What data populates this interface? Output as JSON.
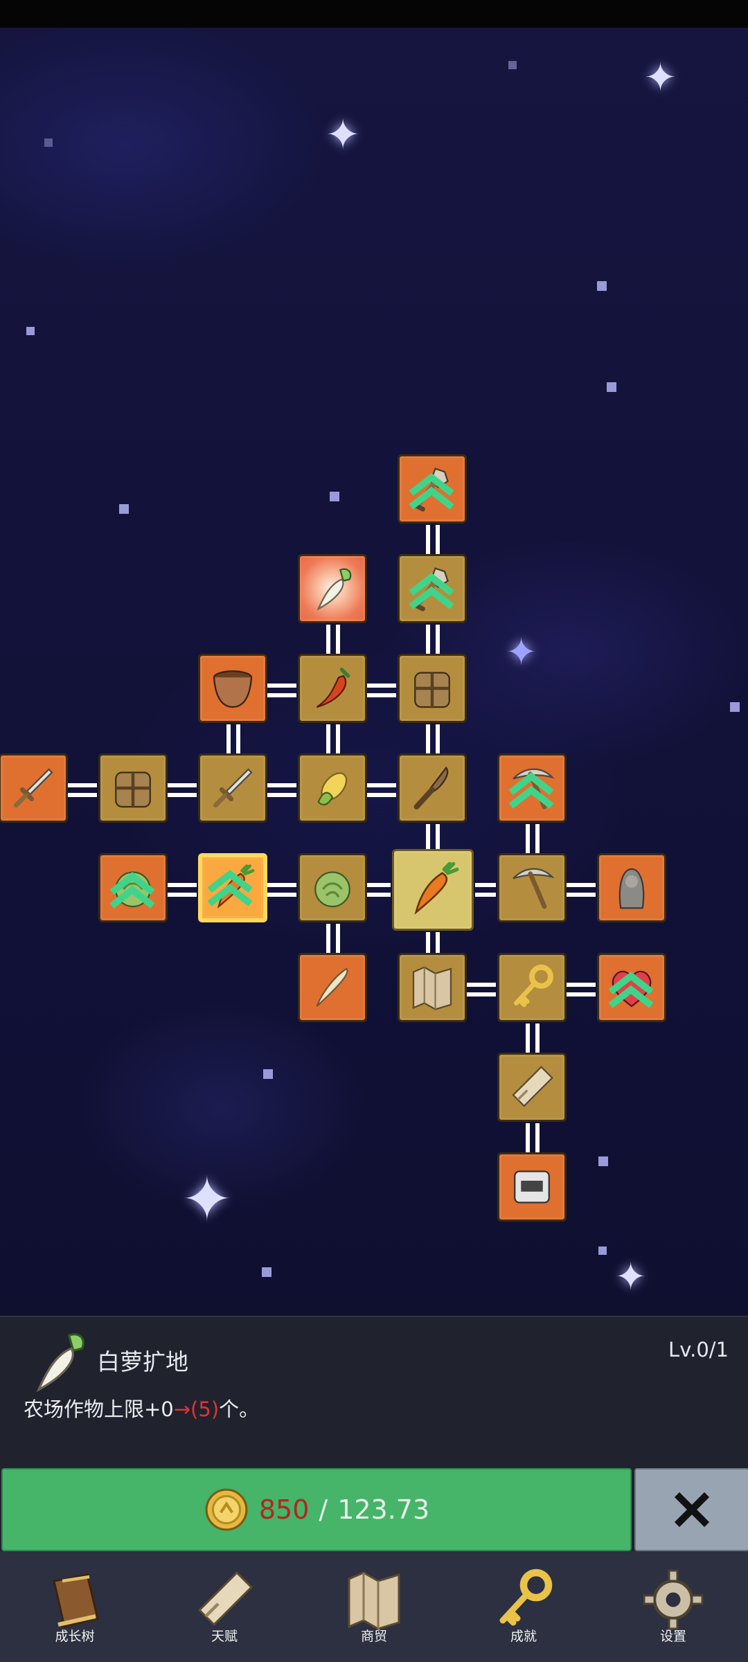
{
  "skill": {
    "name": "白萝扩地",
    "level": "Lv.0/1",
    "desc_prefix": "农场作物上限+0",
    "desc_arrow": "→(5)",
    "desc_suffix": "个。"
  },
  "purchase": {
    "cost": "850",
    "separator": "/",
    "have": "123.73"
  },
  "nav": {
    "growth_tree": "成长树",
    "talent": "天赋",
    "trade": "商贸",
    "achievement": "成就",
    "settings": "设置"
  },
  "colors": {
    "node_gold": "#b48e3e",
    "node_orange": "#e07030",
    "buy_green": "#46b469",
    "cost_red": "#b3261e",
    "panel_bg": "#20232e",
    "nav_bg": "#2d3040"
  },
  "tree_icons": [
    "shovel-icon",
    "radish-icon",
    "chili-icon",
    "corn-icon",
    "carrot-icon",
    "cabbage-icon",
    "pot-icon",
    "backpack-icon",
    "sword-icon",
    "knife-icon",
    "pickaxe-icon",
    "statue-icon",
    "heart-icon",
    "key-icon",
    "map-icon",
    "scroll-icon",
    "machine-icon",
    "root-icon"
  ]
}
